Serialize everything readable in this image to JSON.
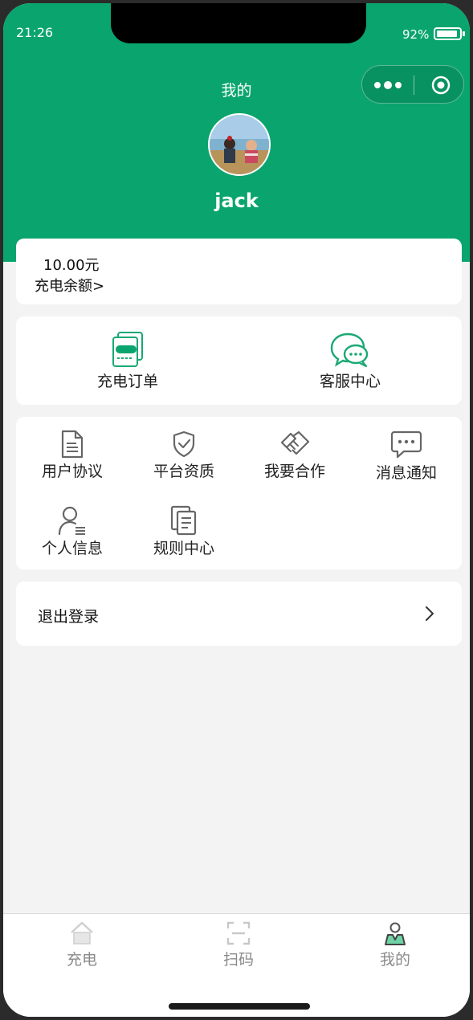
{
  "status_bar": {
    "time": "21:26",
    "battery_text": "92%"
  },
  "header": {
    "title": "我的",
    "username": "jack"
  },
  "balance": {
    "value": "10.00元",
    "label": "充电余额>"
  },
  "quick_actions": [
    {
      "label": "充电订单",
      "icon": "order-document-icon"
    },
    {
      "label": "客服中心",
      "icon": "chat-bubbles-icon"
    }
  ],
  "menu": [
    {
      "label": "用户协议",
      "icon": "document-icon"
    },
    {
      "label": "平台资质",
      "icon": "shield-check-icon"
    },
    {
      "label": "我要合作",
      "icon": "handshake-icon"
    },
    {
      "label": "消息通知",
      "icon": "message-icon"
    },
    {
      "label": "个人信息",
      "icon": "user-profile-icon"
    },
    {
      "label": "规则中心",
      "icon": "rules-stack-icon"
    }
  ],
  "logout": {
    "label": "退出登录"
  },
  "tabbar": [
    {
      "label": "充电",
      "icon": "home-charge-icon"
    },
    {
      "label": "扫码",
      "icon": "scan-icon"
    },
    {
      "label": "我的",
      "icon": "profile-icon"
    }
  ],
  "colors": {
    "brand": "#0aa56f",
    "background": "#f3f3f3"
  }
}
